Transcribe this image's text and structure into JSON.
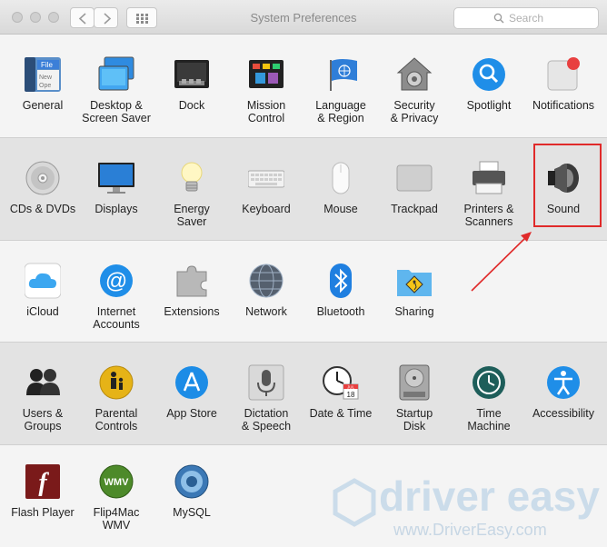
{
  "window": {
    "title": "System Preferences"
  },
  "search": {
    "placeholder": "Search"
  },
  "rows": [
    {
      "items": [
        {
          "id": "general",
          "label1": "General",
          "label2": "",
          "icon": "general-icon",
          "file_label": "File",
          "file_sub": "New",
          "file_sub2": "Ope"
        },
        {
          "id": "desktop",
          "label1": "Desktop &",
          "label2": "Screen Saver",
          "icon": "desktop-icon"
        },
        {
          "id": "dock",
          "label1": "Dock",
          "label2": "",
          "icon": "dock-icon"
        },
        {
          "id": "mission",
          "label1": "Mission",
          "label2": "Control",
          "icon": "mission-control-icon"
        },
        {
          "id": "language",
          "label1": "Language",
          "label2": "& Region",
          "icon": "language-region-icon"
        },
        {
          "id": "security",
          "label1": "Security",
          "label2": "& Privacy",
          "icon": "security-icon"
        },
        {
          "id": "spotlight",
          "label1": "Spotlight",
          "label2": "",
          "icon": "spotlight-icon"
        },
        {
          "id": "notifications",
          "label1": "Notifications",
          "label2": "",
          "icon": "notifications-icon"
        }
      ]
    },
    {
      "items": [
        {
          "id": "cds",
          "label1": "CDs & DVDs",
          "label2": "",
          "icon": "cd-icon"
        },
        {
          "id": "displays",
          "label1": "Displays",
          "label2": "",
          "icon": "display-icon"
        },
        {
          "id": "energy",
          "label1": "Energy",
          "label2": "Saver",
          "icon": "bulb-icon"
        },
        {
          "id": "keyboard",
          "label1": "Keyboard",
          "label2": "",
          "icon": "keyboard-icon"
        },
        {
          "id": "mouse",
          "label1": "Mouse",
          "label2": "",
          "icon": "mouse-icon"
        },
        {
          "id": "trackpad",
          "label1": "Trackpad",
          "label2": "",
          "icon": "trackpad-icon"
        },
        {
          "id": "printers",
          "label1": "Printers &",
          "label2": "Scanners",
          "icon": "printer-icon"
        },
        {
          "id": "sound",
          "label1": "Sound",
          "label2": "",
          "icon": "speaker-icon"
        }
      ]
    },
    {
      "items": [
        {
          "id": "icloud",
          "label1": "iCloud",
          "label2": "",
          "icon": "icloud-icon"
        },
        {
          "id": "internet",
          "label1": "Internet",
          "label2": "Accounts",
          "icon": "at-icon"
        },
        {
          "id": "extensions",
          "label1": "Extensions",
          "label2": "",
          "icon": "puzzle-icon"
        },
        {
          "id": "network",
          "label1": "Network",
          "label2": "",
          "icon": "globe-icon"
        },
        {
          "id": "bluetooth",
          "label1": "Bluetooth",
          "label2": "",
          "icon": "bluetooth-icon"
        },
        {
          "id": "sharing",
          "label1": "Sharing",
          "label2": "",
          "icon": "sharing-folder-icon"
        }
      ]
    },
    {
      "items": [
        {
          "id": "users",
          "label1": "Users &",
          "label2": "Groups",
          "icon": "users-icon"
        },
        {
          "id": "parental",
          "label1": "Parental",
          "label2": "Controls",
          "icon": "parental-icon"
        },
        {
          "id": "appstore",
          "label1": "App Store",
          "label2": "",
          "icon": "app-store-icon"
        },
        {
          "id": "dictation",
          "label1": "Dictation",
          "label2": "& Speech",
          "icon": "microphone-icon"
        },
        {
          "id": "datetime",
          "label1": "Date & Time",
          "label2": "",
          "icon": "clock-calendar-icon",
          "cal_month": "JUL",
          "cal_day": "18"
        },
        {
          "id": "startup",
          "label1": "Startup",
          "label2": "Disk",
          "icon": "disk-icon"
        },
        {
          "id": "timemachine",
          "label1": "Time",
          "label2": "Machine",
          "icon": "time-machine-icon"
        },
        {
          "id": "accessibility",
          "label1": "Accessibility",
          "label2": "",
          "icon": "accessibility-icon"
        }
      ]
    },
    {
      "items": [
        {
          "id": "flash",
          "label1": "Flash Player",
          "label2": "",
          "icon": "flash-icon",
          "glyph": "f"
        },
        {
          "id": "flip4mac",
          "label1": "Flip4Mac",
          "label2": "WMV",
          "icon": "wmv-icon",
          "glyph": "WMV"
        },
        {
          "id": "mysql",
          "label1": "MySQL",
          "label2": "",
          "icon": "mysql-icon"
        }
      ]
    }
  ],
  "watermark": {
    "brand": "driver easy",
    "url": "www.DriverEasy.com"
  },
  "colors": {
    "highlight": "#e02a2a",
    "accent_blue": "#1f8ee8"
  }
}
